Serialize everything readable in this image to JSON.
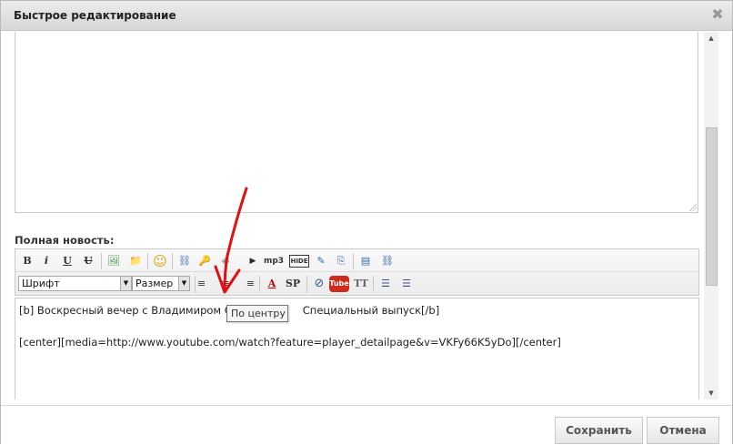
{
  "window": {
    "title": "Быстрое редактирование",
    "close_symbol": "✖"
  },
  "section": {
    "full_news_label": "Полная новость:"
  },
  "toolbar": {
    "row1": [
      {
        "name": "bold-button",
        "glyph": "B"
      },
      {
        "name": "italic-button",
        "glyph": "i"
      },
      {
        "name": "underline-button",
        "glyph": "U"
      },
      {
        "name": "strike-button",
        "glyph": "U"
      },
      {
        "name": "image-button",
        "glyph": "🖼"
      },
      {
        "name": "folder-button",
        "glyph": "📁"
      },
      {
        "name": "smile-button",
        "glyph": "☺"
      },
      {
        "name": "link-button",
        "glyph": "⛓"
      },
      {
        "name": "key-button",
        "glyph": "🔑"
      },
      {
        "name": "flash-button",
        "glyph": "◈"
      },
      {
        "name": "media-button",
        "glyph": "▶"
      },
      {
        "name": "mp3-button",
        "glyph": "mp3"
      },
      {
        "name": "hide-button",
        "glyph": "HIDE"
      },
      {
        "name": "edit-button",
        "glyph": "✎"
      },
      {
        "name": "code-button",
        "glyph": "⎘"
      },
      {
        "name": "page-button",
        "glyph": "▤"
      },
      {
        "name": "pagebreak-button",
        "glyph": "⛓"
      }
    ],
    "font_select": "Шрифт",
    "size_select": "Размер",
    "row2": [
      {
        "name": "align-left-button",
        "glyph": "≡"
      },
      {
        "name": "align-center-button",
        "glyph": "≡"
      },
      {
        "name": "align-right-button",
        "glyph": "≡"
      },
      {
        "name": "color-button",
        "glyph": "A"
      },
      {
        "name": "spoiler-button",
        "glyph": "SP"
      },
      {
        "name": "compass-button",
        "glyph": "⊘"
      },
      {
        "name": "youtube-button",
        "glyph": "Tube"
      },
      {
        "name": "typograph-button",
        "glyph": "TT"
      },
      {
        "name": "bullet-list-button",
        "glyph": "☰"
      },
      {
        "name": "numbered-list-button",
        "glyph": "☰"
      }
    ],
    "colors": {
      "color_glyph": "#c00000",
      "youtube_bg": "#cc2b1d"
    }
  },
  "editor": {
    "line1_a": "[b] Воскресный вечер с Владимиром С",
    "line1_b": "Специальный выпуск[/b]",
    "line2": "[center][media=http://www.youtube.com/watch?feature=player_detailpage&v=VKFy66K5yDo][/center]"
  },
  "tooltip": {
    "text": "По центру"
  },
  "footer": {
    "save_label": "Сохранить",
    "cancel_label": "Отмена"
  },
  "annotation": {
    "arrow_color": "#e01010"
  }
}
